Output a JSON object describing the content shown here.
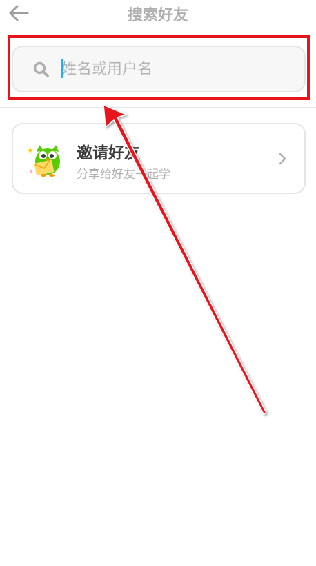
{
  "header": {
    "title": "搜索好友",
    "back_icon": "arrow-left-icon"
  },
  "search": {
    "placeholder": "姓名或用户名",
    "value": "",
    "icon": "search-icon"
  },
  "invite": {
    "title": "邀请好友",
    "subtitle": "分享给好友一起学",
    "icon": "owl-mascot-icon",
    "chevron_icon": "chevron-right-icon"
  },
  "colors": {
    "title_gray": "#afafaf",
    "border": "#e5e5e5",
    "caret": "#1cb0f6",
    "annotation_red": "#e8141b",
    "owl_green": "#58cc02"
  }
}
